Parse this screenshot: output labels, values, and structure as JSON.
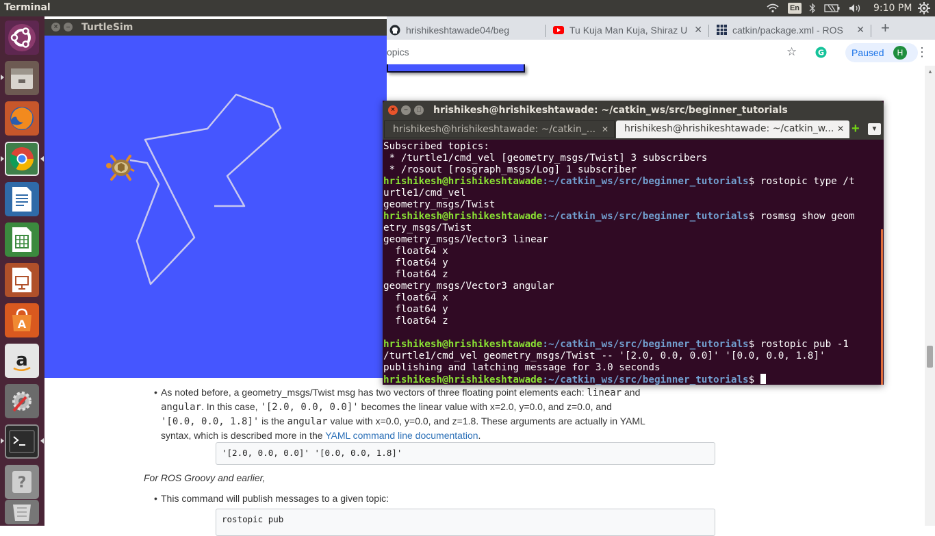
{
  "topbar": {
    "app_name": "Terminal",
    "keyboard_layout": "En",
    "clock": "9:10 PM"
  },
  "launcher": {
    "items": [
      "Ubuntu",
      "Files",
      "Firefox",
      "Chrome",
      "Writer",
      "Calc",
      "Impress",
      "Software",
      "Amazon",
      "Settings",
      "Terminal",
      "Help",
      "Trash"
    ]
  },
  "browser": {
    "tabs": [
      {
        "label": "hrishikeshtawade04/beg",
        "icon": "github-icon"
      },
      {
        "label": "Tu Kuja Man Kuja, Shiraz U",
        "icon": "youtube-icon"
      },
      {
        "label": "catkin/package.xml - ROS",
        "icon": "ros-wiki-icon"
      }
    ],
    "new_tab": "+",
    "partial_text": "opics",
    "sync_label": "Paused",
    "avatar_initial": "H"
  },
  "page": {
    "bullet1_a": "As noted before, a geometry_msgs/Twist msg has two vectors of three floating point elements each: ",
    "bullet1_code1": "linear",
    "bullet1_b": " and",
    "bullet1_code2": "angular",
    "bullet1_c": ". In this case, ",
    "bullet1_code3": "'[2.0, 0.0, 0.0]'",
    "bullet1_d": " becomes the linear value with x=2.0, y=0.0, and z=0.0, and",
    "bullet1_code4": "'[0.0, 0.0, 1.8]'",
    "bullet1_e": " is the ",
    "bullet1_code5": "angular",
    "bullet1_f": " value with x=0.0, y=0.0, and z=1.8. These arguments are actually in YAML",
    "bullet1_g": "syntax, which is described more in the ",
    "bullet1_link": "YAML command line documentation",
    "bullet1_h": ".",
    "code1": "'[2.0, 0.0, 0.0]' '[0.0, 0.0, 1.8]'",
    "groovy_note": "For ROS Groovy and earlier,",
    "bullet2": "This command will publish messages to a given topic:",
    "code2": "rostopic pub"
  },
  "turtlesim": {
    "title": "TurtleSim",
    "background": "#4556ff"
  },
  "terminal": {
    "title": "hrishikesh@hrishikeshtawade: ~/catkin_ws/src/beginner_tutorials",
    "tab1": "hrishikesh@hrishikeshtawade: ~/catkin_...",
    "tab2": "hrishikesh@hrishikeshtawade: ~/catkin_w...",
    "prompt_user": "hrishikesh@hrishikeshtawade",
    "prompt_path": ":~/catkin_ws/src/beginner_tutorials",
    "prompt_symbol": "$ ",
    "line1": "Subscribed topics:",
    "line2": " * /turtle1/cmd_vel [geometry_msgs/Twist] 3 subscribers",
    "line3": " * /rosout [rosgraph_msgs/Log] 1 subscriber",
    "cmd1": "rostopic type /t",
    "cmd1_wrap": "urtle1/cmd_vel",
    "out1": "geometry_msgs/Twist",
    "cmd2": "rosmsg show geom",
    "cmd2_wrap": "etry_msgs/Twist",
    "out2": [
      "geometry_msgs/Vector3 linear",
      "  float64 x",
      "  float64 y",
      "  float64 z",
      "geometry_msgs/Vector3 angular",
      "  float64 x",
      "  float64 y",
      "  float64 z"
    ],
    "cmd3": "rostopic pub -1",
    "cmd3_wrap": "/turtle1/cmd_vel geometry_msgs/Twist -- '[2.0, 0.0, 0.0]' '[0.0, 0.0, 1.8]'",
    "out3": "publishing and latching message for 3.0 seconds"
  }
}
